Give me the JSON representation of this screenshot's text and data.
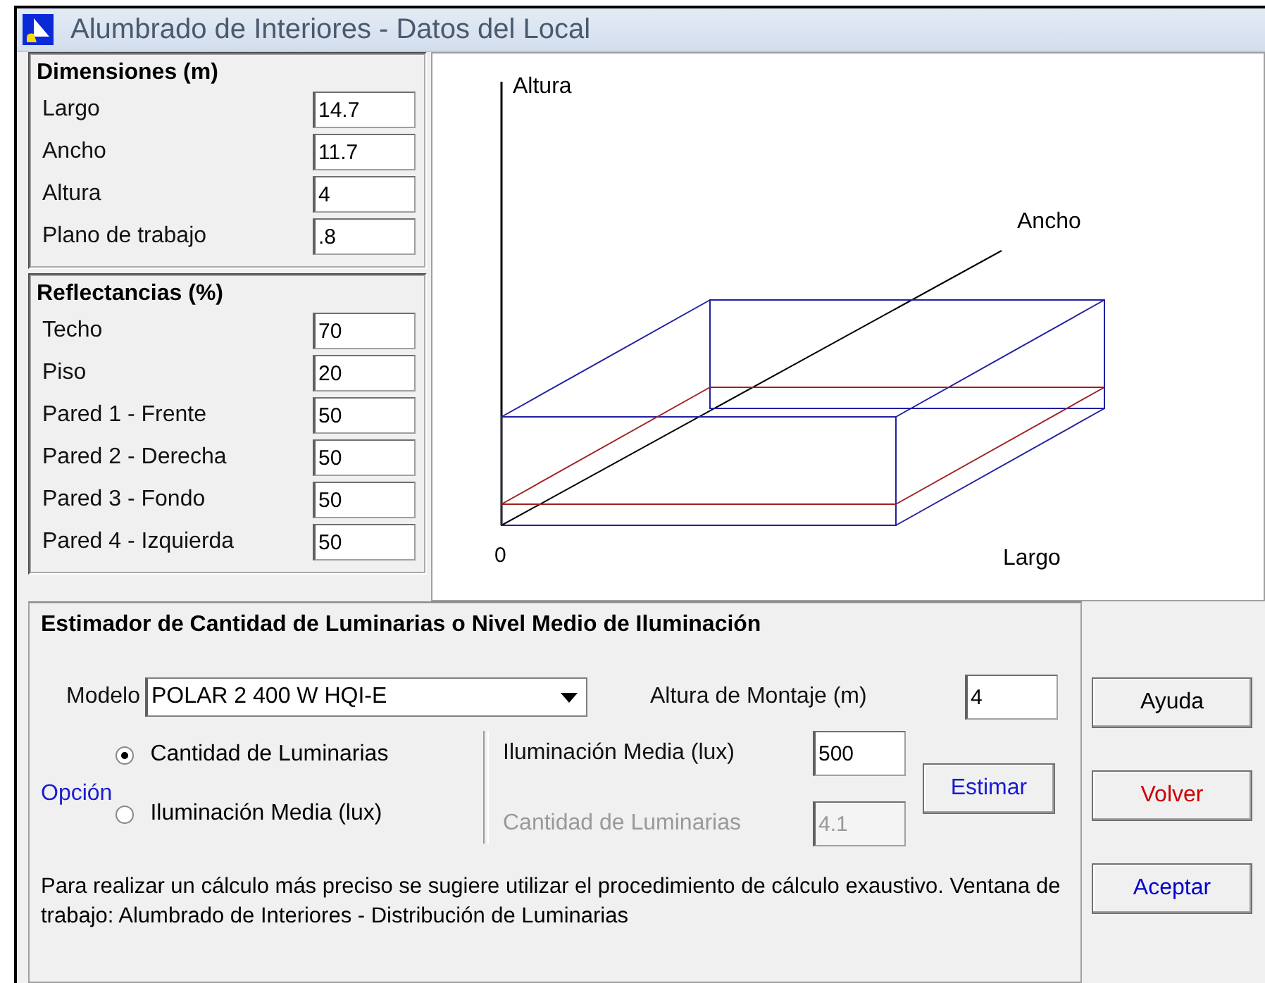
{
  "window": {
    "title": "Alumbrado de Interiores - Datos del Local"
  },
  "dimensions": {
    "title": "Dimensiones (m)",
    "fields": [
      {
        "label": "Largo",
        "value": "14.7"
      },
      {
        "label": "Ancho",
        "value": "11.7"
      },
      {
        "label": "Altura",
        "value": "4"
      },
      {
        "label": "Plano de trabajo",
        "value": ".8"
      }
    ]
  },
  "reflectances": {
    "title": "Reflectancias (%)",
    "fields": [
      {
        "label": "Techo",
        "value": "70"
      },
      {
        "label": "Piso",
        "value": "20"
      },
      {
        "label": "Pared 1 - Frente",
        "value": "50"
      },
      {
        "label": "Pared 2 - Derecha",
        "value": "50"
      },
      {
        "label": "Pared 3 - Fondo",
        "value": "50"
      },
      {
        "label": "Pared 4 - Izquierda",
        "value": "50"
      }
    ]
  },
  "diagram": {
    "height_axis": "Altura",
    "width_axis": "Ancho",
    "origin": "0",
    "length_axis": "Largo"
  },
  "estimator": {
    "title": "Estimador de Cantidad de Luminarias o Nivel Medio de Iluminación",
    "model_label": "Modelo",
    "model": "POLAR 2 400 W HQI-E",
    "mount_label": "Altura de Montaje (m)",
    "mount_value": "4",
    "option_label": "Opción",
    "options": [
      {
        "label": "Cantidad de Luminarias",
        "selected": true
      },
      {
        "label": "Iluminación Media (lux)",
        "selected": false
      }
    ],
    "fields": [
      {
        "label": "Iluminación Media (lux)",
        "value": "500",
        "disabled": false
      },
      {
        "label": "Cantidad de Luminarias",
        "value": "4.1",
        "disabled": true
      }
    ],
    "estimate_button": "Estimar",
    "note": "Para realizar un cálculo más preciso se sugiere utilizar el procedimiento de cálculo exaustivo. Ventana de trabajo: Alumbrado de Interiores - Distribución de Luminarias"
  },
  "buttons": [
    {
      "label": "Ayuda",
      "color": "#000000"
    },
    {
      "label": "Volver",
      "color": "#cc0000"
    },
    {
      "label": "Aceptar",
      "color": "#0000cc"
    }
  ]
}
